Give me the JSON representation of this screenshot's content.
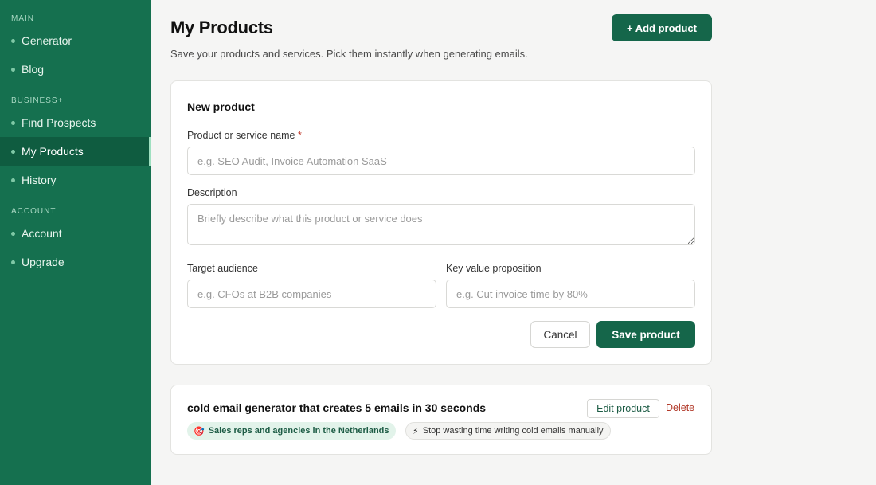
{
  "sidebar": {
    "sections": [
      {
        "label": "MAIN",
        "items": [
          {
            "label": "Generator",
            "active": false
          },
          {
            "label": "Blog",
            "active": false
          }
        ]
      },
      {
        "label": "BUSINESS+",
        "items": [
          {
            "label": "Find Prospects",
            "active": false
          },
          {
            "label": "My Products",
            "active": true
          },
          {
            "label": "History",
            "active": false
          }
        ]
      },
      {
        "label": "ACCOUNT",
        "items": [
          {
            "label": "Account",
            "active": false
          },
          {
            "label": "Upgrade",
            "active": false
          }
        ]
      }
    ]
  },
  "page": {
    "title": "My Products",
    "subtitle": "Save your products and services. Pick them instantly when generating emails.",
    "add_button": "+ Add product"
  },
  "form": {
    "title": "New product",
    "name_label": "Product or service name",
    "required_mark": "*",
    "name_placeholder": "e.g. SEO Audit, Invoice Automation SaaS",
    "name_value": "",
    "description_label": "Description",
    "description_placeholder": "Briefly describe what this product or service does",
    "description_value": "",
    "audience_label": "Target audience",
    "audience_placeholder": "e.g. CFOs at B2B companies",
    "audience_value": "",
    "value_label": "Key value proposition",
    "value_placeholder": "e.g. Cut invoice time by 80%",
    "value_value": "",
    "cancel_label": "Cancel",
    "save_label": "Save product"
  },
  "products": [
    {
      "name": "cold email generator that creates 5 emails in 30 seconds",
      "edit_label": "Edit product",
      "delete_label": "Delete",
      "audience_icon": "🎯",
      "audience": "Sales reps and agencies in the Netherlands",
      "value_icon": "⚡",
      "value": "Stop wasting time writing cold emails manually"
    }
  ],
  "colors": {
    "sidebar_bg": "#15704f",
    "sidebar_active": "#0f5c40",
    "primary_button": "#15664a",
    "delete": "#b23a2a"
  }
}
